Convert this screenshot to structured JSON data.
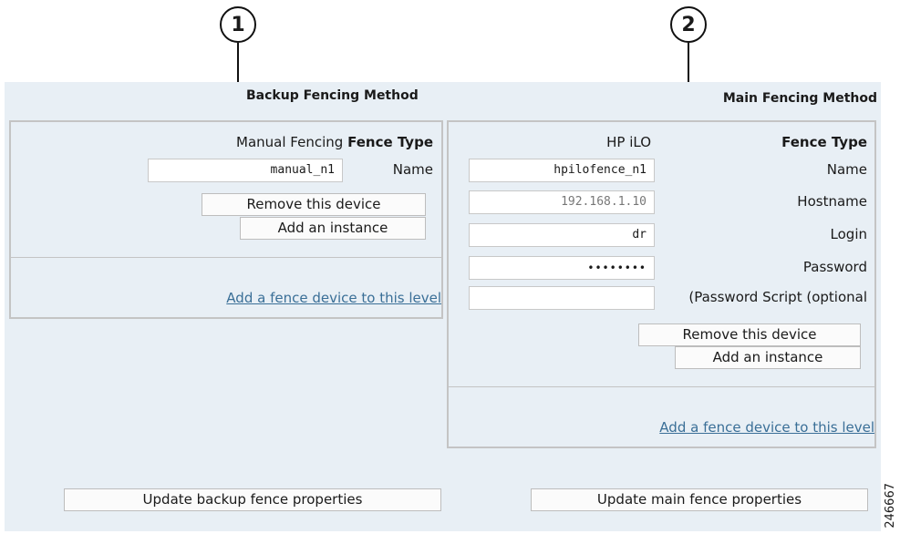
{
  "callouts": [
    "1",
    "2"
  ],
  "backup": {
    "title": "Backup Fencing Method",
    "type_value": "Manual Fencing",
    "type_label": "Fence Type",
    "name_value": "manual_n1",
    "name_label": "Name",
    "remove_button": "Remove this device",
    "add_instance_button": "Add an instance",
    "add_device_link": "Add a fence device to this level",
    "update_button": "Update backup fence properties"
  },
  "main": {
    "title": "Main Fencing Method",
    "type_value": "HP iLO",
    "type_label": "Fence Type",
    "name_value": "hpilofence_n1",
    "name_label": "Name",
    "hostname_value": "192.168.1.10",
    "hostname_label": "Hostname",
    "login_value": "dr",
    "login_label": "Login",
    "password_value": "••••••••",
    "password_label": "Password",
    "password_script_value": "",
    "password_script_label": "(Password Script (optional",
    "remove_button": "Remove this device",
    "add_instance_button": "Add an instance",
    "add_device_link": "Add a fence device to this level",
    "update_button": "Update main fence properties"
  },
  "figure_id": "246667"
}
